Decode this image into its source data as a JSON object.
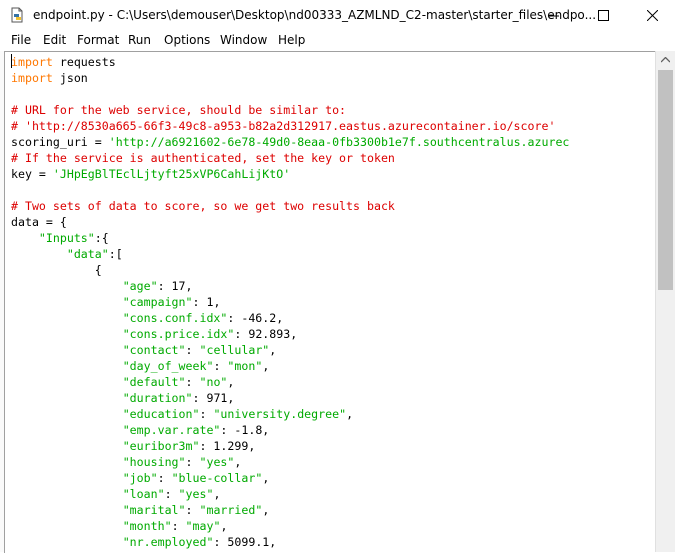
{
  "window": {
    "title": "endpoint.py - C:\\Users\\demouser\\Desktop\\nd00333_AZMLND_C2-master\\starter_files\\endpo...",
    "icon": "python-file-icon",
    "controls": {
      "minimize": "minimize-icon",
      "maximize": "maximize-icon",
      "close": "close-icon"
    }
  },
  "menu": [
    "File",
    "Edit",
    "Format",
    "Run",
    "Options",
    "Window",
    "Help"
  ],
  "colors": {
    "keyword": "#ff7700",
    "comment": "#dd0000",
    "string": "#00aa00",
    "default": "#000000"
  },
  "code_lines": [
    [
      {
        "t": "kw",
        "v": "import"
      },
      {
        "t": "n",
        "v": " requests"
      }
    ],
    [
      {
        "t": "kw",
        "v": "import"
      },
      {
        "t": "n",
        "v": " json"
      }
    ],
    [],
    [
      {
        "t": "cm",
        "v": "# URL for the web service, should be similar to:"
      }
    ],
    [
      {
        "t": "cm",
        "v": "# 'http://8530a665-66f3-49c8-a953-b82a2d312917.eastus.azurecontainer.io/score'"
      }
    ],
    [
      {
        "t": "n",
        "v": "scoring_uri = "
      },
      {
        "t": "st",
        "v": "'http://a6921602-6e78-49d0-8eaa-0fb3300b1e7f.southcentralus.azurec"
      }
    ],
    [
      {
        "t": "cm",
        "v": "# If the service is authenticated, set the key or token"
      }
    ],
    [
      {
        "t": "n",
        "v": "key = "
      },
      {
        "t": "st",
        "v": "'JHpEgBlTEclLjtyft25xVP6CahLijKtO'"
      }
    ],
    [],
    [
      {
        "t": "cm",
        "v": "# Two sets of data to score, so we get two results back"
      }
    ],
    [
      {
        "t": "n",
        "v": "data = {"
      }
    ],
    [
      {
        "t": "n",
        "v": "    "
      },
      {
        "t": "st",
        "v": "\"Inputs\""
      },
      {
        "t": "n",
        "v": ":{"
      }
    ],
    [
      {
        "t": "n",
        "v": "        "
      },
      {
        "t": "st",
        "v": "\"data\""
      },
      {
        "t": "n",
        "v": ":["
      }
    ],
    [
      {
        "t": "n",
        "v": "            {"
      }
    ],
    [
      {
        "t": "n",
        "v": "                "
      },
      {
        "t": "st",
        "v": "\"age\""
      },
      {
        "t": "n",
        "v": ": 17,"
      }
    ],
    [
      {
        "t": "n",
        "v": "                "
      },
      {
        "t": "st",
        "v": "\"campaign\""
      },
      {
        "t": "n",
        "v": ": 1,"
      }
    ],
    [
      {
        "t": "n",
        "v": "                "
      },
      {
        "t": "st",
        "v": "\"cons.conf.idx\""
      },
      {
        "t": "n",
        "v": ": -46.2,"
      }
    ],
    [
      {
        "t": "n",
        "v": "                "
      },
      {
        "t": "st",
        "v": "\"cons.price.idx\""
      },
      {
        "t": "n",
        "v": ": 92.893,"
      }
    ],
    [
      {
        "t": "n",
        "v": "                "
      },
      {
        "t": "st",
        "v": "\"contact\""
      },
      {
        "t": "n",
        "v": ": "
      },
      {
        "t": "st",
        "v": "\"cellular\""
      },
      {
        "t": "n",
        "v": ","
      }
    ],
    [
      {
        "t": "n",
        "v": "                "
      },
      {
        "t": "st",
        "v": "\"day_of_week\""
      },
      {
        "t": "n",
        "v": ": "
      },
      {
        "t": "st",
        "v": "\"mon\""
      },
      {
        "t": "n",
        "v": ","
      }
    ],
    [
      {
        "t": "n",
        "v": "                "
      },
      {
        "t": "st",
        "v": "\"default\""
      },
      {
        "t": "n",
        "v": ": "
      },
      {
        "t": "st",
        "v": "\"no\""
      },
      {
        "t": "n",
        "v": ","
      }
    ],
    [
      {
        "t": "n",
        "v": "                "
      },
      {
        "t": "st",
        "v": "\"duration\""
      },
      {
        "t": "n",
        "v": ": 971,"
      }
    ],
    [
      {
        "t": "n",
        "v": "                "
      },
      {
        "t": "st",
        "v": "\"education\""
      },
      {
        "t": "n",
        "v": ": "
      },
      {
        "t": "st",
        "v": "\"university.degree\""
      },
      {
        "t": "n",
        "v": ","
      }
    ],
    [
      {
        "t": "n",
        "v": "                "
      },
      {
        "t": "st",
        "v": "\"emp.var.rate\""
      },
      {
        "t": "n",
        "v": ": -1.8,"
      }
    ],
    [
      {
        "t": "n",
        "v": "                "
      },
      {
        "t": "st",
        "v": "\"euribor3m\""
      },
      {
        "t": "n",
        "v": ": 1.299,"
      }
    ],
    [
      {
        "t": "n",
        "v": "                "
      },
      {
        "t": "st",
        "v": "\"housing\""
      },
      {
        "t": "n",
        "v": ": "
      },
      {
        "t": "st",
        "v": "\"yes\""
      },
      {
        "t": "n",
        "v": ","
      }
    ],
    [
      {
        "t": "n",
        "v": "                "
      },
      {
        "t": "st",
        "v": "\"job\""
      },
      {
        "t": "n",
        "v": ": "
      },
      {
        "t": "st",
        "v": "\"blue-collar\""
      },
      {
        "t": "n",
        "v": ","
      }
    ],
    [
      {
        "t": "n",
        "v": "                "
      },
      {
        "t": "st",
        "v": "\"loan\""
      },
      {
        "t": "n",
        "v": ": "
      },
      {
        "t": "st",
        "v": "\"yes\""
      },
      {
        "t": "n",
        "v": ","
      }
    ],
    [
      {
        "t": "n",
        "v": "                "
      },
      {
        "t": "st",
        "v": "\"marital\""
      },
      {
        "t": "n",
        "v": ": "
      },
      {
        "t": "st",
        "v": "\"married\""
      },
      {
        "t": "n",
        "v": ","
      }
    ],
    [
      {
        "t": "n",
        "v": "                "
      },
      {
        "t": "st",
        "v": "\"month\""
      },
      {
        "t": "n",
        "v": ": "
      },
      {
        "t": "st",
        "v": "\"may\""
      },
      {
        "t": "n",
        "v": ","
      }
    ],
    [
      {
        "t": "n",
        "v": "                "
      },
      {
        "t": "st",
        "v": "\"nr.employed\""
      },
      {
        "t": "n",
        "v": ": 5099.1,"
      }
    ]
  ]
}
